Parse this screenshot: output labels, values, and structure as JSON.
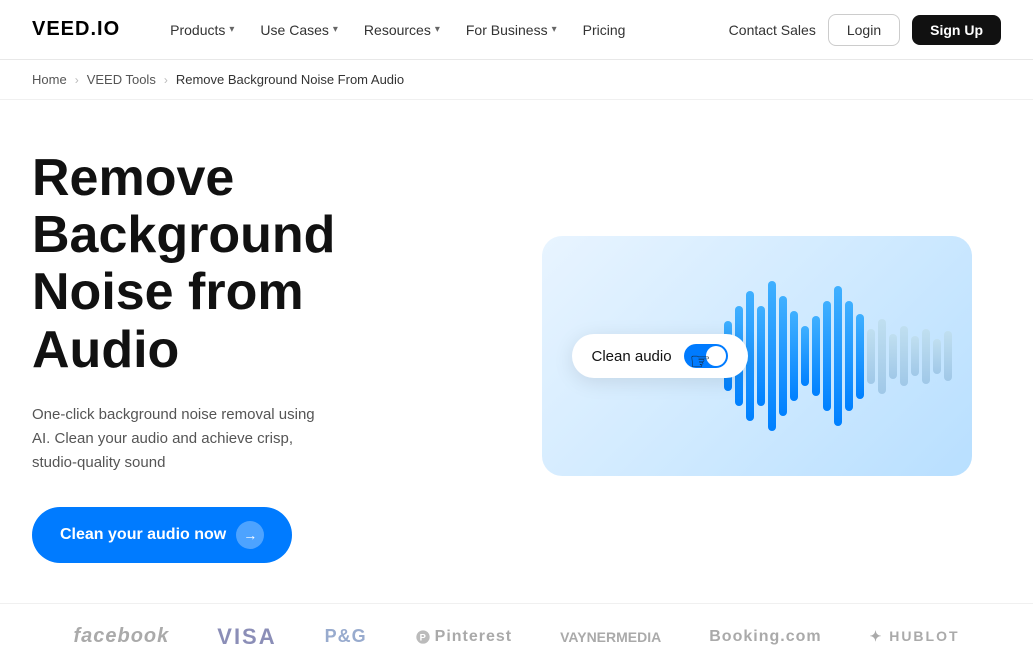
{
  "nav": {
    "logo": "VEED.IO",
    "items": [
      {
        "label": "Products",
        "has_dropdown": true
      },
      {
        "label": "Use Cases",
        "has_dropdown": true
      },
      {
        "label": "Resources",
        "has_dropdown": true
      },
      {
        "label": "For Business",
        "has_dropdown": true
      },
      {
        "label": "Pricing",
        "has_dropdown": false
      }
    ],
    "contact_sales": "Contact Sales",
    "login": "Login",
    "signup": "Sign Up"
  },
  "breadcrumb": {
    "home": "Home",
    "tools": "VEED Tools",
    "current": "Remove Background Noise From Audio"
  },
  "hero": {
    "title": "Remove Background Noise from Audio",
    "description": "One-click background noise removal using AI. Clean your audio and achieve crisp, studio-quality sound",
    "cta_label": "Clean your audio now",
    "badge_text": "Clean audio"
  },
  "logos": [
    {
      "name": "facebook",
      "display": "facebook",
      "class": "facebook"
    },
    {
      "name": "visa",
      "display": "VISA",
      "class": "visa"
    },
    {
      "name": "pg",
      "display": "P&G",
      "class": "pg"
    },
    {
      "name": "pinterest",
      "display": "⬤ Pinterest",
      "class": "pinterest"
    },
    {
      "name": "vaynermedia",
      "display": "VAYNERMEDIA",
      "class": "vayner"
    },
    {
      "name": "booking",
      "display": "Booking.com",
      "class": "booking"
    },
    {
      "name": "hublot",
      "display": "⌖ HUBLOT",
      "class": "hublot"
    }
  ],
  "waveform_bars": [
    {
      "height": 40,
      "muted": false
    },
    {
      "height": 70,
      "muted": false
    },
    {
      "height": 100,
      "muted": false
    },
    {
      "height": 130,
      "muted": false
    },
    {
      "height": 100,
      "muted": false
    },
    {
      "height": 150,
      "muted": false
    },
    {
      "height": 120,
      "muted": false
    },
    {
      "height": 90,
      "muted": false
    },
    {
      "height": 60,
      "muted": false
    },
    {
      "height": 80,
      "muted": false
    },
    {
      "height": 110,
      "muted": false
    },
    {
      "height": 140,
      "muted": false
    },
    {
      "height": 110,
      "muted": false
    },
    {
      "height": 85,
      "muted": false
    },
    {
      "height": 55,
      "muted": true
    },
    {
      "height": 75,
      "muted": true
    },
    {
      "height": 45,
      "muted": true
    },
    {
      "height": 60,
      "muted": true
    },
    {
      "height": 40,
      "muted": true
    },
    {
      "height": 55,
      "muted": true
    },
    {
      "height": 35,
      "muted": true
    },
    {
      "height": 50,
      "muted": true
    }
  ]
}
